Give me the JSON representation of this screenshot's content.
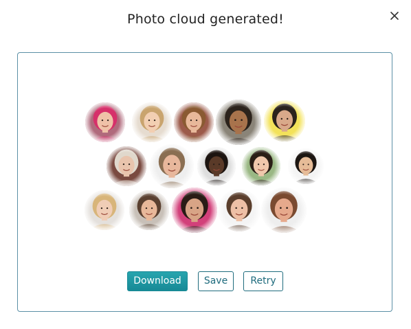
{
  "modal": {
    "title": "Photo cloud generated!",
    "close_icon": "close-icon"
  },
  "colors": {
    "accent": "#1b97a3",
    "border": "#5a8fa5",
    "outline_button": "#1e6b7d"
  },
  "cloud": {
    "photo_count": 15,
    "photos": [
      {
        "name": "woman-pink-hair",
        "skin": "#efc2a8",
        "hair": "#d6306a",
        "bg": "#b06a7c"
      },
      {
        "name": "woman-blonde-smiling",
        "skin": "#f2cfb2",
        "hair": "#c9a46e",
        "bg": "#e6dcd0"
      },
      {
        "name": "girl-curly-hair",
        "skin": "#e8b89a",
        "hair": "#8a5a32",
        "bg": "#9c5a4a"
      },
      {
        "name": "man-dark-smiling",
        "skin": "#a8734c",
        "hair": "#2c231c",
        "bg": "#8a8478"
      },
      {
        "name": "man-yellow-background",
        "skin": "#d9a98a",
        "hair": "#2a221c",
        "bg": "#f3e25a"
      },
      {
        "name": "woman-platinum-hair",
        "skin": "#e9c4ad",
        "hair": "#e0d8cc",
        "bg": "#7a4a40"
      },
      {
        "name": "man-blond-beard",
        "skin": "#e8b79c",
        "hair": "#8a6e52",
        "bg": "#eeeeee"
      },
      {
        "name": "man-suit-tie",
        "skin": "#5a3a28",
        "hair": "#1c1410",
        "bg": "#dedede"
      },
      {
        "name": "woman-asian-long-hair",
        "skin": "#f0c8ac",
        "hair": "#2a1e16",
        "bg": "#9ab884"
      },
      {
        "name": "man-asian-short-hair",
        "skin": "#e6bc98",
        "hair": "#1c1612",
        "bg": "#f4f4f4"
      },
      {
        "name": "woman-blonde-straight",
        "skin": "#f0cdb6",
        "hair": "#d8b57a",
        "bg": "#e4e0dc"
      },
      {
        "name": "man-young-smiling",
        "skin": "#e8b89a",
        "hair": "#5a4030",
        "bg": "#c8c0b8"
      },
      {
        "name": "woman-dark-curly",
        "skin": "#d8a486",
        "hair": "#2a1c16",
        "bg": "#d2407a"
      },
      {
        "name": "man-short-brown-hair",
        "skin": "#eec0a6",
        "hair": "#5a3e2c",
        "bg": "#f4f4f4"
      },
      {
        "name": "man-bald-beard",
        "skin": "#e6a98c",
        "hair": "#7a4a30",
        "bg": "#eeeeee"
      }
    ]
  },
  "actions": {
    "download_label": "Download",
    "save_label": "Save",
    "retry_label": "Retry"
  }
}
